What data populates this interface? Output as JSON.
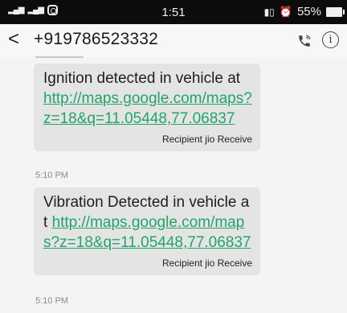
{
  "status_bar": {
    "time": "1:51",
    "battery": "55%"
  },
  "header": {
    "contact": "+919786523332",
    "back_glyph": "<",
    "info_glyph": "i"
  },
  "messages": [
    {
      "text": "Ignition detected in vehicle at ",
      "link": "http://maps.google.com/maps?z=18&q=11.05448,77.06837",
      "sim": "Recipient jio Receive",
      "time": "5:10 PM"
    },
    {
      "text": "Vibration Detected in vehicle at ",
      "link": "http://maps.google.com/maps?z=18&q=11.05448,77.06837",
      "sim": "Recipient jio Receive",
      "time": "5:10 PM"
    }
  ],
  "colors": {
    "link": "#21a56b",
    "bubble": "#e4e4e4",
    "status_bar": "#0c0c0c"
  }
}
